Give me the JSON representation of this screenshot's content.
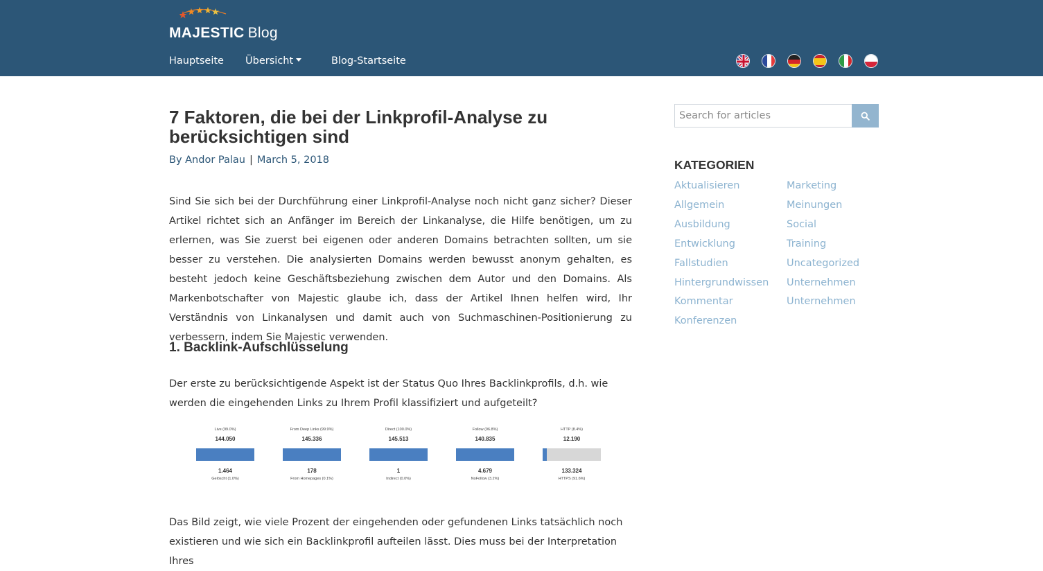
{
  "brand": {
    "name": "MAJESTIC",
    "suffix": "Blog"
  },
  "nav": {
    "home": "Hauptseite",
    "overview": "Übersicht",
    "blog_home": "Blog-Startseite"
  },
  "languages": [
    "english-flag-icon",
    "french-flag-icon",
    "german-flag-icon",
    "spanish-flag-icon",
    "italian-flag-icon",
    "polish-flag-icon"
  ],
  "article": {
    "title": "7 Faktoren, die bei der Linkprofil-Analyse zu berücksichtigen sind",
    "author": "By Andor Palau",
    "separator": "|",
    "date": "March 5, 2018",
    "intro": "Sind Sie sich bei der Durchführung einer Linkprofil-Analyse noch nicht ganz sicher? Dieser Artikel richtet sich an Anfänger im Bereich der Linkanalyse, die Hilfe benötigen, um zu erlernen, was Sie zuerst bei eigenen oder anderen Domains betrachten sollten, um sie besser zu verstehen. Die analysierten Domains werden bewusst anonym gehalten, es besteht jedoch keine Geschäftsbeziehung zwischen dem Autor und den Domains. Als Markenbotschafter von Majestic glaube ich, dass der Artikel Ihnen helfen wird, Ihr Verständnis von Linkanalysen und damit auch von Suchmaschinen-Positionierung zu verbessern, indem Sie Majestic verwenden.",
    "section1_heading": "1. Backlink-Aufschlüsselung",
    "section1_text": "Der erste zu berücksichtigende Aspekt ist der Status Quo Ihres Backlinkprofils, d.h. wie werden die eingehenden Links zu Ihrem Profil klassifiziert und aufgeteilt?",
    "after_image_text": "Das Bild zeigt, wie viele Prozent der eingehenden oder gefundenen Links tatsächlich noch existieren und wie sich ein Backlinkprofil aufteilen lässt. Dies muss bei der Interpretation Ihres"
  },
  "figure_stats": [
    {
      "top_label": "Live (99.0%)",
      "top_value": "144.050",
      "bottom_value": "1.464",
      "bottom_label": "Gelöscht (1.0%)",
      "top_fraction": 0.99
    },
    {
      "top_label": "From Deep Links (99.9%)",
      "top_value": "145.336",
      "bottom_value": "178",
      "bottom_label": "From Homepages (0.1%)",
      "top_fraction": 0.999
    },
    {
      "top_label": "Direct (100.0%)",
      "top_value": "145.513",
      "bottom_value": "1",
      "bottom_label": "Indirect (0.0%)",
      "top_fraction": 1.0
    },
    {
      "top_label": "Follow (96.8%)",
      "top_value": "140.835",
      "bottom_value": "4.679",
      "bottom_label": "NoFollow (3.2%)",
      "top_fraction": 0.968
    },
    {
      "top_label": "HTTP (8.4%)",
      "top_value": "12.190",
      "bottom_value": "133.324",
      "bottom_label": "HTTPS (91.6%)",
      "top_fraction": 0.084
    }
  ],
  "sidebar": {
    "search_placeholder": "Search for articles",
    "categories_title": "KATEGORIEN",
    "categories_col1": [
      "Aktualisieren",
      "Allgemein",
      "Ausbildung",
      "Entwicklung",
      "Fallstudien",
      "Hintergrundwissen",
      "Kommentar",
      "Konferenzen"
    ],
    "categories_col2": [
      "Marketing",
      "Meinungen",
      "Social",
      "Training",
      "Uncategorized",
      "Unternehmen",
      "Unternehmen"
    ]
  },
  "colors": {
    "header_bg": "#2c5677",
    "link_blue": "#2c5677",
    "category_blue": "#8cb3d0",
    "search_button": "#93b5cf",
    "bar_blue": "#4a7fc1",
    "bar_grey": "#d7d7d7"
  }
}
